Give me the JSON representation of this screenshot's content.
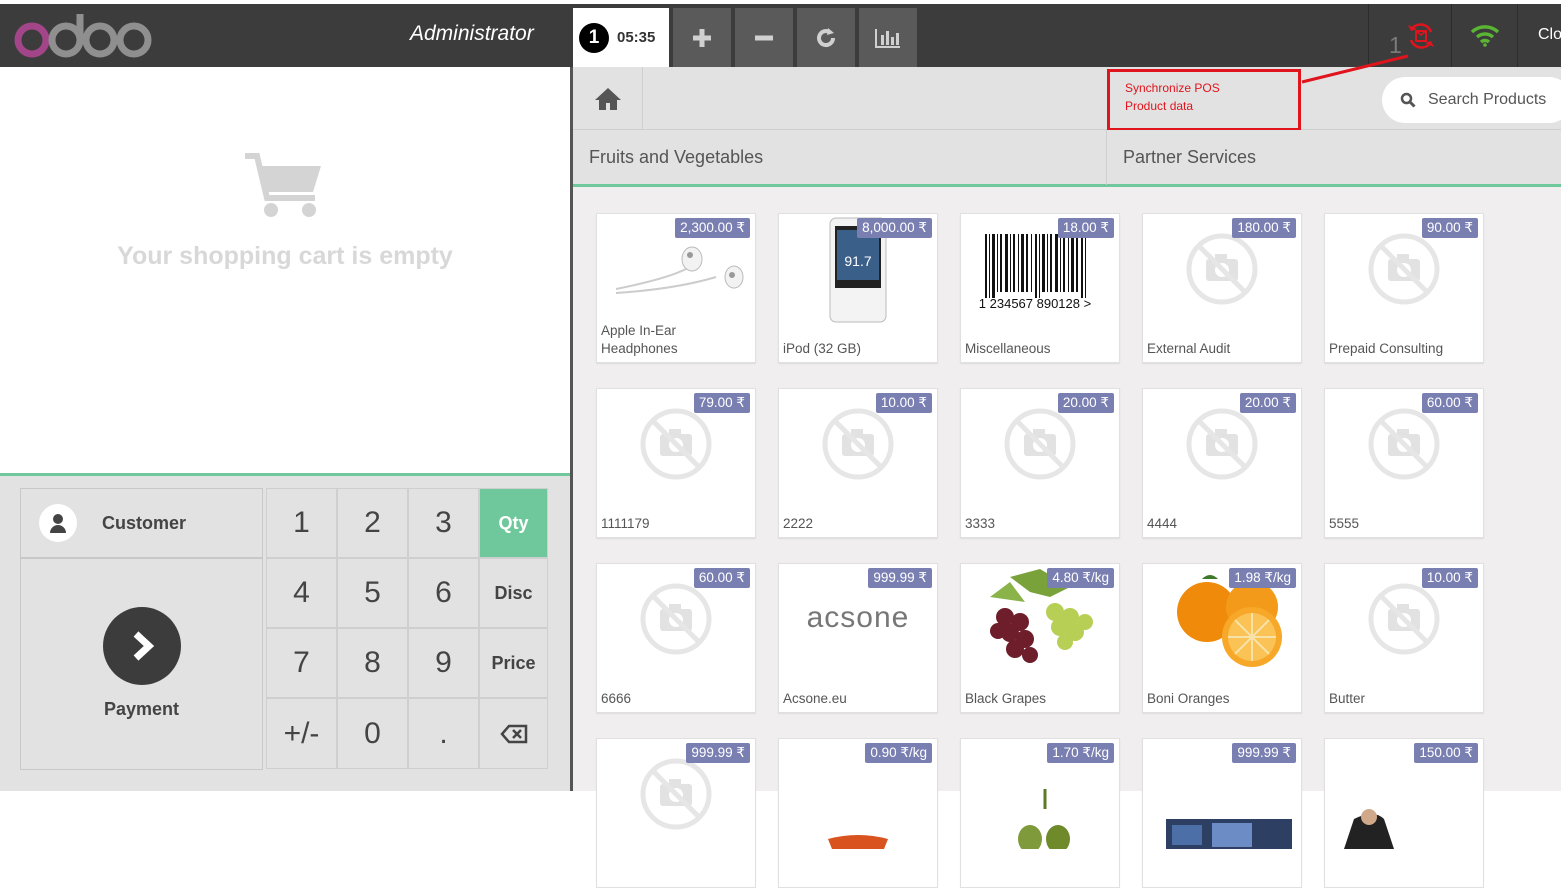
{
  "app": {
    "logo_text": "odoo",
    "user_name": "Administrator",
    "close_label": "Clo"
  },
  "order": {
    "number": "1",
    "time": "05:35"
  },
  "toolbar": {
    "add_icon": "plus-icon",
    "remove_icon": "minus-icon",
    "refresh_icon": "refresh-icon",
    "stats_icon": "bar-chart-icon"
  },
  "sync": {
    "pending_count": "1",
    "annotation_line1": "Synchronize POS",
    "annotation_line2": "Product data",
    "annotation_color": "#e0141c"
  },
  "colors": {
    "topbar": "#3c3c3c",
    "accent_green": "#6ec89b",
    "price_badge": "#7a7fb2",
    "wifi_green": "#59b532"
  },
  "cart": {
    "empty_text": "Your shopping cart is empty"
  },
  "pad": {
    "customer_label": "Customer",
    "payment_label": "Payment",
    "keys": [
      "1",
      "2",
      "3",
      "Qty",
      "4",
      "5",
      "6",
      "Disc",
      "7",
      "8",
      "9",
      "Price",
      "+/-",
      "0",
      ".",
      "⌫"
    ],
    "active_mode": "Qty"
  },
  "search": {
    "placeholder": "Search Products"
  },
  "categories": [
    "Fruits and Vegetables",
    "Partner Services"
  ],
  "products": [
    {
      "name": "Apple In-Ear Headphones",
      "price": "2,300.00 ₹",
      "image": "headphones"
    },
    {
      "name": "iPod (32 GB)",
      "price": "8,000.00 ₹",
      "image": "ipod"
    },
    {
      "name": "Miscellaneous",
      "price": "18.00 ₹",
      "image": "barcode"
    },
    {
      "name": "External Audit",
      "price": "180.00 ₹",
      "image": "no-photo"
    },
    {
      "name": "Prepaid Consulting",
      "price": "90.00 ₹",
      "image": "no-photo"
    },
    {
      "name": "1111179",
      "price": "79.00 ₹",
      "image": "no-photo"
    },
    {
      "name": "2222",
      "price": "10.00 ₹",
      "image": "no-photo"
    },
    {
      "name": "3333",
      "price": "20.00 ₹",
      "image": "no-photo"
    },
    {
      "name": "4444",
      "price": "20.00 ₹",
      "image": "no-photo"
    },
    {
      "name": "5555",
      "price": "60.00 ₹",
      "image": "no-photo"
    },
    {
      "name": "6666",
      "price": "60.00 ₹",
      "image": "no-photo"
    },
    {
      "name": "Acsone.eu",
      "price": "999.99 ₹",
      "image": "acsone"
    },
    {
      "name": "Black Grapes",
      "price": "4.80 ₹/kg",
      "image": "grapes"
    },
    {
      "name": "Boni Oranges",
      "price": "1.98 ₹/kg",
      "image": "oranges"
    },
    {
      "name": "Butter",
      "price": "10.00 ₹",
      "image": "no-photo"
    },
    {
      "name": "",
      "price": "999.99 ₹",
      "image": "no-photo"
    },
    {
      "name": "",
      "price": "0.90 ₹/kg",
      "image": "carrots"
    },
    {
      "name": "",
      "price": "1.70 ₹/kg",
      "image": "peppers"
    },
    {
      "name": "",
      "price": "999.99 ₹",
      "image": "screens"
    },
    {
      "name": "",
      "price": "150.00 ₹",
      "image": "person"
    }
  ]
}
